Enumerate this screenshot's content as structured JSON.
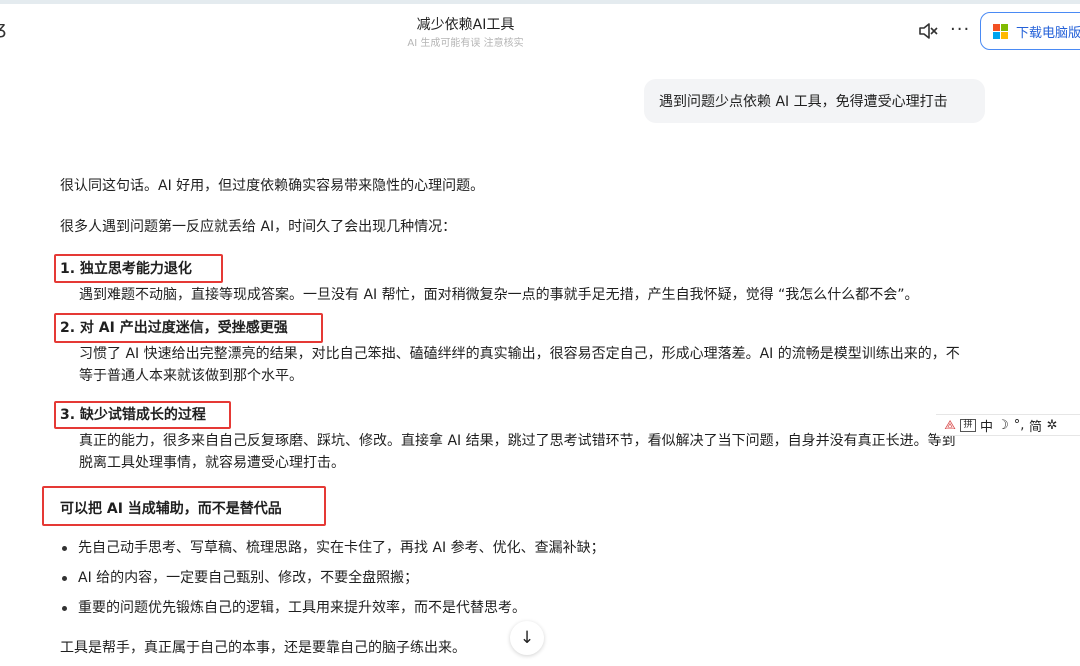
{
  "header": {
    "title": "减少依赖AI工具",
    "subtitle": "AI 生成可能有误 注意核实",
    "download_label": "下载电脑版",
    "more_glyph": "···",
    "mute_icon": "speaker-muted-icon"
  },
  "user_message": "遇到问题少点依赖 AI 工具，免得遭受心理打击",
  "answer": {
    "intro": "很认同这句话。AI 好用，但过度依赖确实容易带来隐性的心理问题。",
    "lead": "很多人遇到问题第一反应就丢给 AI，时间久了会出现几种情况：",
    "items": [
      {
        "head": "1. 独立思考能力退化",
        "body": "遇到难题不动脑，直接等现成答案。一旦没有 AI 帮忙，面对稍微复杂一点的事就手足无措，产生自我怀疑，觉得 “我怎么什么都不会”。"
      },
      {
        "head": "2. 对 AI 产出过度迷信，受挫感更强",
        "body": "习惯了 AI 快速给出完整漂亮的结果，对比自己笨拙、磕磕绊绊的真实输出，很容易否定自己，形成心理落差。AI 的流畅是模型训练出来的，不等于普通人本来就该做到那个水平。"
      },
      {
        "head": "3. 缺少试错成长的过程",
        "body": "真正的能力，很多来自自己反复琢磨、踩坑、修改。直接拿 AI 结果，跳过了思考试错环节，看似解决了当下问题，自身并没有真正长进。等到脱离工具处理事情，就容易遭受心理打击。"
      }
    ],
    "section_head": "可以把 AI 当成辅助，而不是替代品",
    "bullets": [
      "先自己动手思考、写草稿、梳理思路，实在卡住了，再找 AI 参考、优化、查漏补缺；",
      "AI 给的内容，一定要自己甄别、修改，不要全盘照搬；",
      "重要的问题优先锻炼自己的逻辑，工具用来提升效率，而不是代替思考。"
    ],
    "closing": "工具是帮手，真正属于自己的本事，还是要靠自己的脑子练出来。"
  },
  "ime_toolbar": {
    "pinyin": "拼",
    "lang": "中",
    "moon": "☽",
    "punct": "°,",
    "simplified": "简",
    "gear": "✲"
  },
  "colors": {
    "highlight_box": "#e53935",
    "button_border": "#4a8af4",
    "button_text": "#2461d8",
    "bubble_bg": "#f3f4f6"
  }
}
